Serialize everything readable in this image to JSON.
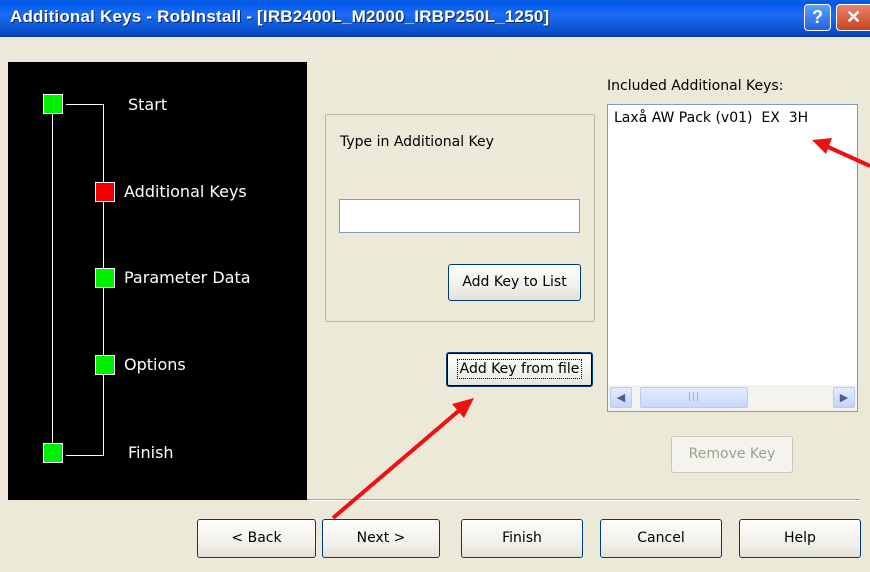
{
  "window": {
    "title": "Additional Keys - RobInstall - [IRB2400L_M2000_IRBP250L_1250]",
    "help_button": "?",
    "close_button": "✕"
  },
  "wizard_steps": [
    {
      "label": "Start",
      "status": "done"
    },
    {
      "label": "Additional Keys",
      "status": "current"
    },
    {
      "label": "Parameter Data",
      "status": "done"
    },
    {
      "label": "Options",
      "status": "done"
    },
    {
      "label": "Finish",
      "status": "done"
    }
  ],
  "key_entry": {
    "label": "Type in Additional Key",
    "value": "",
    "add_to_list_button": "Add Key to List",
    "add_from_file_button": "Add Key from file"
  },
  "included_keys": {
    "label": "Included Additional Keys:",
    "items": [
      "Laxå AW Pack (v01)  EX  3H"
    ],
    "remove_button": "Remove Key"
  },
  "footer": {
    "back_button": "< Back",
    "next_button": "Next >",
    "finish_button": "Finish",
    "cancel_button": "Cancel",
    "help_button": "Help"
  },
  "colors": {
    "step_done": "#00EE00",
    "step_current": "#EE0000",
    "annotation_arrow": "#EE1111"
  }
}
